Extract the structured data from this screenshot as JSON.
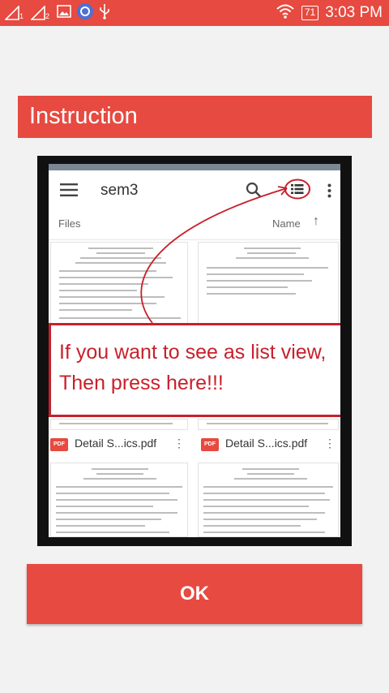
{
  "status_bar": {
    "sim1_label": "1",
    "sim2_label": "2",
    "battery": "71",
    "time": "3:03 PM"
  },
  "dialog": {
    "title": "Instruction",
    "ok_label": "OK"
  },
  "instruction_image": {
    "toolbar_title": "sem3",
    "files_label": "Files",
    "sort_label": "Name",
    "file_badge": "PDF",
    "file_left": "Detail S...ics.pdf",
    "file_right": "Detail S...ics.pdf",
    "callout_text": "If you want to see as list view, Then press here!!!"
  },
  "colors": {
    "accent": "#e64a40",
    "callout_red": "#c8202b"
  }
}
